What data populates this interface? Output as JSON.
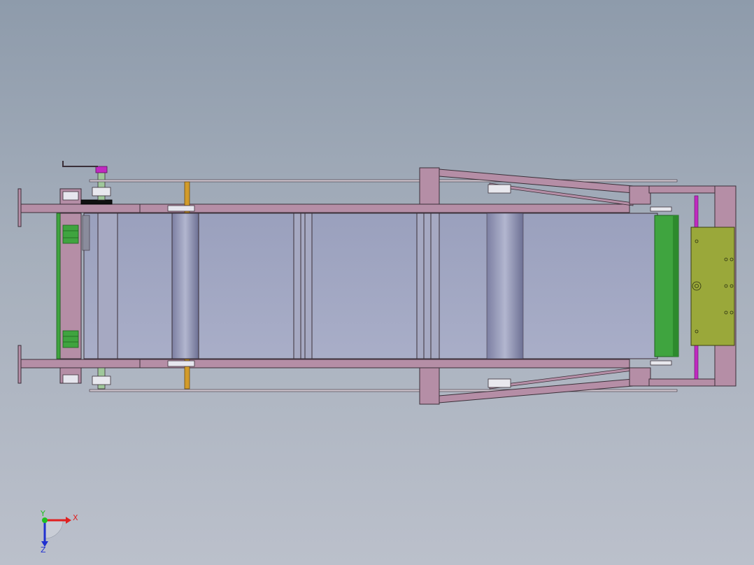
{
  "viewport": {
    "background_top": "#8e9bab",
    "background_bottom": "#bbc0cb"
  },
  "model": {
    "frame_color": "#b58ea6",
    "frame_edge": "#3a2f38",
    "belt_color": "#a3a8c2",
    "roller_color": "#8d90b2",
    "motor_color": "#9aa83a",
    "green_part": "#3fa43f",
    "bolt_color": "#d29b2a",
    "magenta_part": "#c02ac0"
  },
  "triad": {
    "x_label": "X",
    "y_label": "Y",
    "z_label": "Z",
    "x_color": "#e02020",
    "y_color": "#20c020",
    "z_color": "#2030d0"
  }
}
